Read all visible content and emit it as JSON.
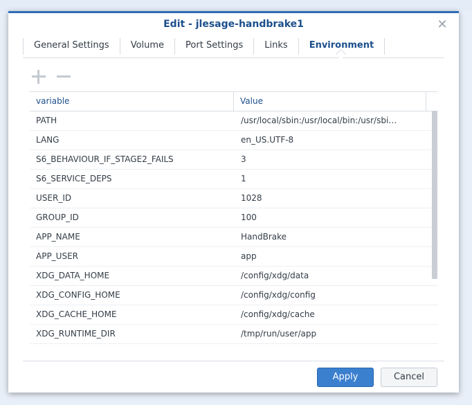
{
  "dialog": {
    "title": "Edit - jlesage-handbrake1",
    "tabs": [
      {
        "label": "General Settings"
      },
      {
        "label": "Volume"
      },
      {
        "label": "Port Settings"
      },
      {
        "label": "Links"
      },
      {
        "label": "Environment",
        "active": true
      }
    ],
    "table": {
      "headers": {
        "variable": "variable",
        "value": "Value"
      },
      "rows": [
        {
          "variable": "PATH",
          "value": "/usr/local/sbin:/usr/local/bin:/usr/sbi…"
        },
        {
          "variable": "LANG",
          "value": "en_US.UTF-8"
        },
        {
          "variable": "S6_BEHAVIOUR_IF_STAGE2_FAILS",
          "value": "3"
        },
        {
          "variable": "S6_SERVICE_DEPS",
          "value": "1"
        },
        {
          "variable": "USER_ID",
          "value": "1028"
        },
        {
          "variable": "GROUP_ID",
          "value": "100"
        },
        {
          "variable": "APP_NAME",
          "value": "HandBrake"
        },
        {
          "variable": "APP_USER",
          "value": "app"
        },
        {
          "variable": "XDG_DATA_HOME",
          "value": "/config/xdg/data"
        },
        {
          "variable": "XDG_CONFIG_HOME",
          "value": "/config/xdg/config"
        },
        {
          "variable": "XDG_CACHE_HOME",
          "value": "/config/xdg/cache"
        },
        {
          "variable": "XDG_RUNTIME_DIR",
          "value": "/tmp/run/user/app"
        }
      ]
    },
    "buttons": {
      "apply": "Apply",
      "cancel": "Cancel"
    },
    "icons": {
      "close": "close-icon",
      "add": "plus-icon",
      "remove": "minus-icon"
    },
    "colors": {
      "accent": "#2f6db5",
      "title": "#1c4f8c",
      "apply_bg": "#3b7fcf"
    }
  }
}
